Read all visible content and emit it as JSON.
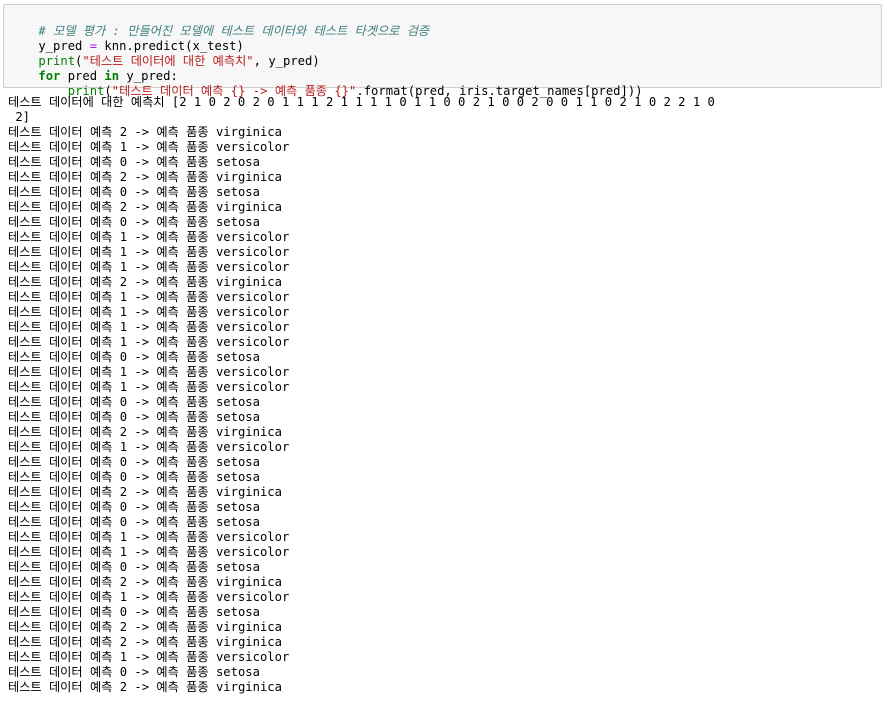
{
  "code_cell": {
    "comment": "# 모델 평가 : 만들어진 모델에 테스트 데이터와 테스트 타겟으로 검증",
    "line2": {
      "var": "y_pred ",
      "op": "=",
      "rest": " knn.predict(x_test)"
    },
    "line3": {
      "func": "print",
      "open": "(",
      "str": "\"테스트 데이터에 대한 예측치\"",
      "rest": ", y_pred)"
    },
    "line4": {
      "kw_for": "for",
      "var": " pred ",
      "kw_in": "in",
      "rest": " y_pred:"
    },
    "line5": {
      "indent": "    ",
      "func": "print",
      "open": "(",
      "str": "\"테스트 데이터 예측 {} -> 예측 품종 {}\"",
      "rest": ".format(pred, iris.target_names[pred]))"
    }
  },
  "output": {
    "header_line1": "테스트 데이터에 대한 예측치 [2 1 0 2 0 2 0 1 1 1 2 1 1 1 1 0 1 1 0 0 2 1 0 0 2 0 0 1 1 0 2 1 0 2 2 1 0",
    "header_line2": " 2]",
    "prefix": "테스트 데이터 예측 ",
    "arrow": " -> 예측 품종 ",
    "predictions": [
      {
        "value": "2",
        "species": "virginica"
      },
      {
        "value": "1",
        "species": "versicolor"
      },
      {
        "value": "0",
        "species": "setosa"
      },
      {
        "value": "2",
        "species": "virginica"
      },
      {
        "value": "0",
        "species": "setosa"
      },
      {
        "value": "2",
        "species": "virginica"
      },
      {
        "value": "0",
        "species": "setosa"
      },
      {
        "value": "1",
        "species": "versicolor"
      },
      {
        "value": "1",
        "species": "versicolor"
      },
      {
        "value": "1",
        "species": "versicolor"
      },
      {
        "value": "2",
        "species": "virginica"
      },
      {
        "value": "1",
        "species": "versicolor"
      },
      {
        "value": "1",
        "species": "versicolor"
      },
      {
        "value": "1",
        "species": "versicolor"
      },
      {
        "value": "1",
        "species": "versicolor"
      },
      {
        "value": "0",
        "species": "setosa"
      },
      {
        "value": "1",
        "species": "versicolor"
      },
      {
        "value": "1",
        "species": "versicolor"
      },
      {
        "value": "0",
        "species": "setosa"
      },
      {
        "value": "0",
        "species": "setosa"
      },
      {
        "value": "2",
        "species": "virginica"
      },
      {
        "value": "1",
        "species": "versicolor"
      },
      {
        "value": "0",
        "species": "setosa"
      },
      {
        "value": "0",
        "species": "setosa"
      },
      {
        "value": "2",
        "species": "virginica"
      },
      {
        "value": "0",
        "species": "setosa"
      },
      {
        "value": "0",
        "species": "setosa"
      },
      {
        "value": "1",
        "species": "versicolor"
      },
      {
        "value": "1",
        "species": "versicolor"
      },
      {
        "value": "0",
        "species": "setosa"
      },
      {
        "value": "2",
        "species": "virginica"
      },
      {
        "value": "1",
        "species": "versicolor"
      },
      {
        "value": "0",
        "species": "setosa"
      },
      {
        "value": "2",
        "species": "virginica"
      },
      {
        "value": "2",
        "species": "virginica"
      },
      {
        "value": "1",
        "species": "versicolor"
      },
      {
        "value": "0",
        "species": "setosa"
      },
      {
        "value": "2",
        "species": "virginica"
      }
    ]
  },
  "colors": {
    "comment": "#408080",
    "keyword": "#008000",
    "string": "#ba2121",
    "operator": "#aa22ff",
    "cell_background": "#f7f7f7",
    "cell_border": "#cfcfcf"
  }
}
